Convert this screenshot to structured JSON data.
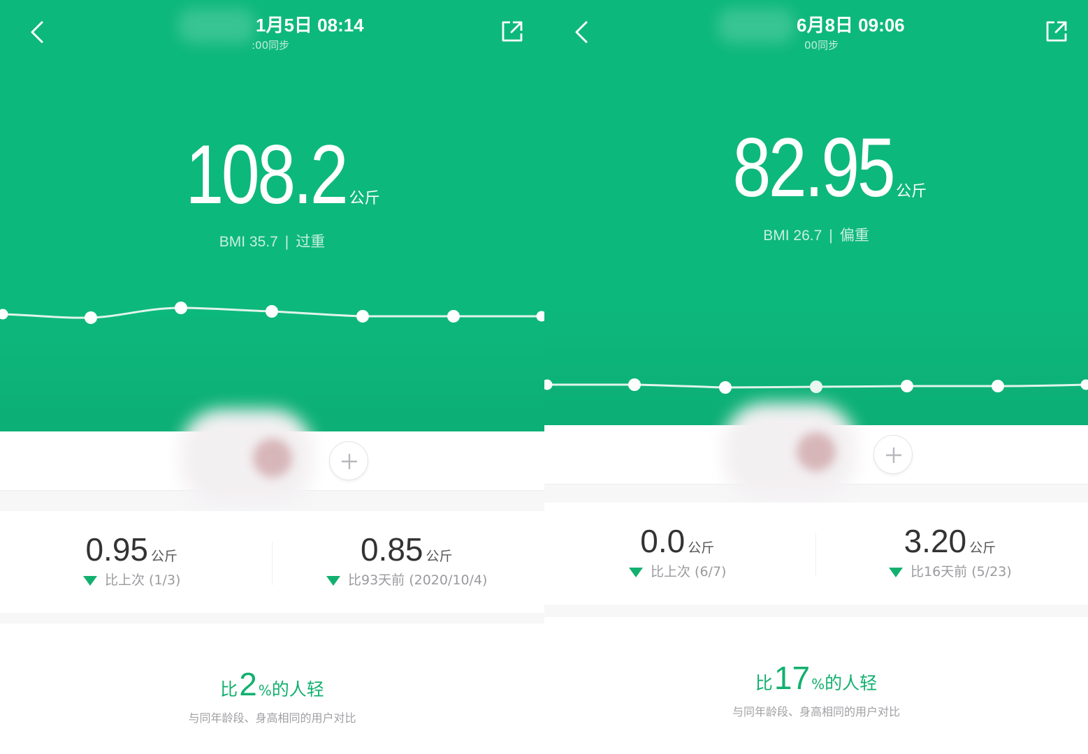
{
  "theme": {
    "accent": "#0db87c",
    "text_dark": "#333333",
    "text_muted": "#9a9a9e",
    "down_arrow": "#12b06f"
  },
  "left": {
    "header": {
      "title": "1月5日 08:14",
      "subtitle": ":00同步"
    },
    "weight": {
      "value": "108.2",
      "unit": "公斤"
    },
    "bmi": {
      "label": "BMI 35.7",
      "separator": "|",
      "status": "过重"
    },
    "stats": [
      {
        "value": "0.95",
        "unit": "公斤",
        "compare": "比上次 (1/3)",
        "direction": "down"
      },
      {
        "value": "0.85",
        "unit": "公斤",
        "compare": "比93天前 (2020/10/4)",
        "direction": "down"
      }
    ],
    "percentile": {
      "prefix": "比",
      "number": "2",
      "suffix_sign": "%",
      "suffix": "的人轻",
      "note": "与同年龄段、身高相同的用户对比"
    }
  },
  "right": {
    "header": {
      "title": "6月8日 09:06",
      "subtitle": "00同步"
    },
    "weight": {
      "value": "82.95",
      "unit": "公斤"
    },
    "bmi": {
      "label": "BMI 26.7",
      "separator": "|",
      "status": "偏重"
    },
    "stats": [
      {
        "value": "0.0",
        "unit": "公斤",
        "compare": "比上次 (6/7)",
        "direction": "down"
      },
      {
        "value": "3.20",
        "unit": "公斤",
        "compare": "比16天前 (5/23)",
        "direction": "down"
      }
    ],
    "percentile": {
      "prefix": "比",
      "number": "17",
      "suffix_sign": "%",
      "suffix": "的人轻",
      "note": "与同年龄段、身高相同的用户对比"
    }
  },
  "icons": {
    "back": "chevron-left-icon",
    "share": "share-external-icon",
    "add": "plus-icon",
    "trend_down": "triangle-down-icon"
  }
}
